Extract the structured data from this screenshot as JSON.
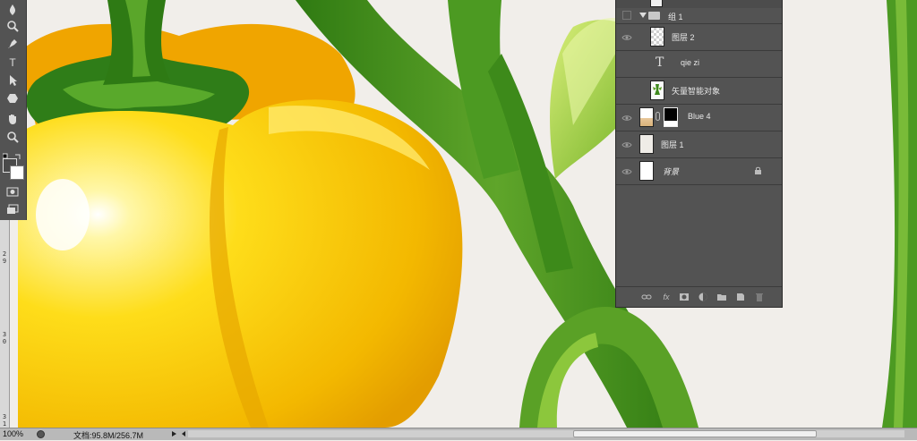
{
  "toolbar": {
    "tools": [
      "burn-icon",
      "zoom-icon",
      "pen-icon",
      "type-tool",
      "path-select-icon",
      "shape-icon",
      "hand-icon",
      "zoom-tool-icon"
    ],
    "type_glyph": "T"
  },
  "ruler": {
    "marks": [
      "2",
      "9",
      "3",
      "0",
      "3",
      "1"
    ]
  },
  "layers": {
    "rows": [
      {
        "name": "组 1",
        "type": "group"
      },
      {
        "name": "图层 2",
        "type": "pixel"
      },
      {
        "name": "qie zi",
        "type": "text"
      },
      {
        "name": "矢量智能对象",
        "type": "smart"
      },
      {
        "name": "Blue 4",
        "type": "adjust"
      },
      {
        "name": "图层 1",
        "type": "pixel"
      },
      {
        "name": "背景",
        "type": "background"
      }
    ],
    "text_glyph": "T",
    "footer_buttons": [
      "link-icon",
      "fx-icon",
      "mask-icon",
      "adjustment-icon",
      "folder-icon",
      "new-layer-icon",
      "trash-icon"
    ],
    "fx_label": "fx"
  },
  "status": {
    "zoom": "100%",
    "doc": "文档:95.8M/256.7M"
  },
  "colors": {
    "canvas_bg": "#f1eeea",
    "pepper": "#f5c400",
    "stem": "#3f8a1e",
    "panel": "#535353"
  }
}
